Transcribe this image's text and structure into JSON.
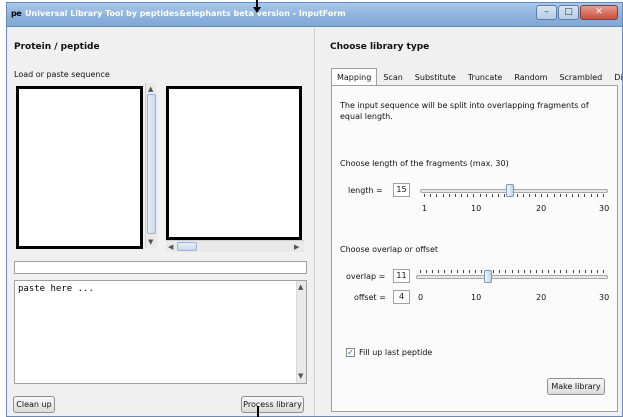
{
  "window": {
    "icon_text": "pe",
    "title": "Universal Library Tool  by peptides&elephants  beta version - InputForm",
    "controls": [
      "–",
      "□",
      "✕"
    ]
  },
  "left": {
    "heading": "Protein / peptide",
    "load_label": "Load or paste sequence",
    "paste_text": "paste here ...",
    "clean_button": "Clean up",
    "process_button": "Process library"
  },
  "right": {
    "heading": "Choose library type",
    "tabs": [
      "Mapping",
      "Scan",
      "Substitute",
      "Truncate",
      "Random",
      "Scrambled",
      "Digest"
    ],
    "active_tab": "Mapping",
    "description": "The input sequence will be split into overlapping fragments of equal length.",
    "length_section": "Choose length of the fragments (max. 30)",
    "length_label": "length =",
    "length_value": "15",
    "length_scale": [
      "1",
      "10",
      "20",
      "30"
    ],
    "length_slider_fraction": 0.48,
    "overlap_section": "Choose overlap or offset",
    "overlap_label": "overlap =",
    "overlap_value": "11",
    "offset_label": "offset =",
    "offset_value": "4",
    "offset_scale": [
      "0",
      "10",
      "20",
      "30"
    ],
    "overlap_slider_fraction": 0.37,
    "fill_label": "Fill up last peptide",
    "fill_checked": true,
    "make_button": "Make library"
  }
}
